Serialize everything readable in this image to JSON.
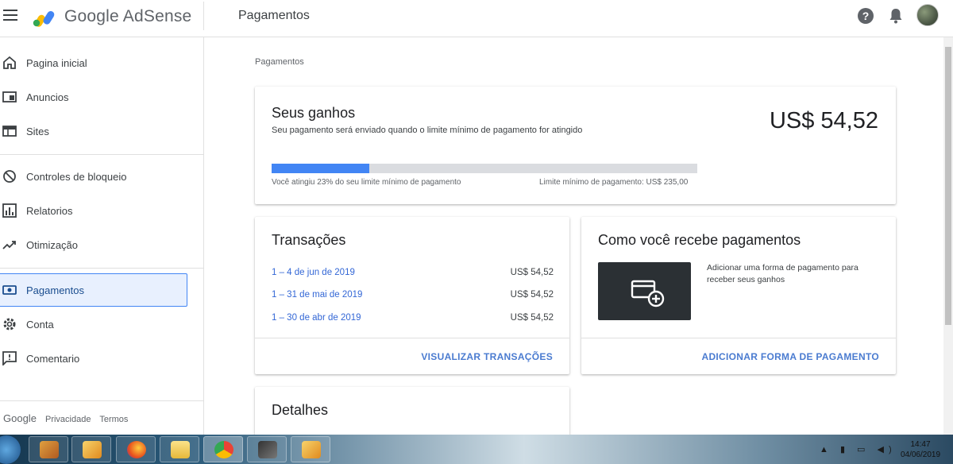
{
  "app": {
    "brand": "Google AdSense",
    "page_title": "Pagamentos"
  },
  "sidebar": {
    "items": [
      {
        "label": "Pagina inicial",
        "icon": "home-icon"
      },
      {
        "label": "Anuncios",
        "icon": "ads-icon"
      },
      {
        "label": "Sites",
        "icon": "sites-icon"
      },
      {
        "label": "Controles de bloqueio",
        "icon": "block-icon"
      },
      {
        "label": "Relatorios",
        "icon": "reports-icon"
      },
      {
        "label": "Otimização",
        "icon": "optimization-icon"
      },
      {
        "label": "Pagamentos",
        "icon": "payments-icon",
        "active": true
      },
      {
        "label": "Conta",
        "icon": "gear-icon"
      },
      {
        "label": "Comentario",
        "icon": "feedback-icon"
      }
    ],
    "footer": {
      "google": "Google",
      "privacy": "Privacidade",
      "terms": "Termos"
    }
  },
  "main": {
    "breadcrumb": "Pagamentos",
    "earnings": {
      "title": "Seus ganhos",
      "subtitle": "Seu pagamento será enviado quando o limite mínimo de pagamento for atingido",
      "amount": "US$ 54,52",
      "progress_fraction": 0.23,
      "progress_left": "Você atingiu 23% do seu limite mínimo de pagamento",
      "progress_right": "Limite mínimo de pagamento: US$ 235,00"
    },
    "transactions": {
      "title": "Transações",
      "rows": [
        {
          "period": "1 – 4 de jun de 2019",
          "amount": "US$ 54,52"
        },
        {
          "period": "1 – 31 de mai de 2019",
          "amount": "US$ 54,52"
        },
        {
          "period": "1 – 30 de abr de 2019",
          "amount": "US$ 54,52"
        }
      ],
      "action": "VISUALIZAR TRANSAÇÕES"
    },
    "payment_method": {
      "title": "Como você recebe pagamentos",
      "text": "Adicionar uma forma de pagamento para receber seus ganhos",
      "icon": "add-card-icon",
      "action": "ADICIONAR FORMA DE PAGAMENTO"
    },
    "details": {
      "title": "Detalhes"
    }
  },
  "taskbar": {
    "time": "14:47",
    "date": "04/06/2019"
  },
  "colors": {
    "accent": "#4285f4",
    "link": "#3367d6",
    "active_bg": "#e8f0fe"
  }
}
